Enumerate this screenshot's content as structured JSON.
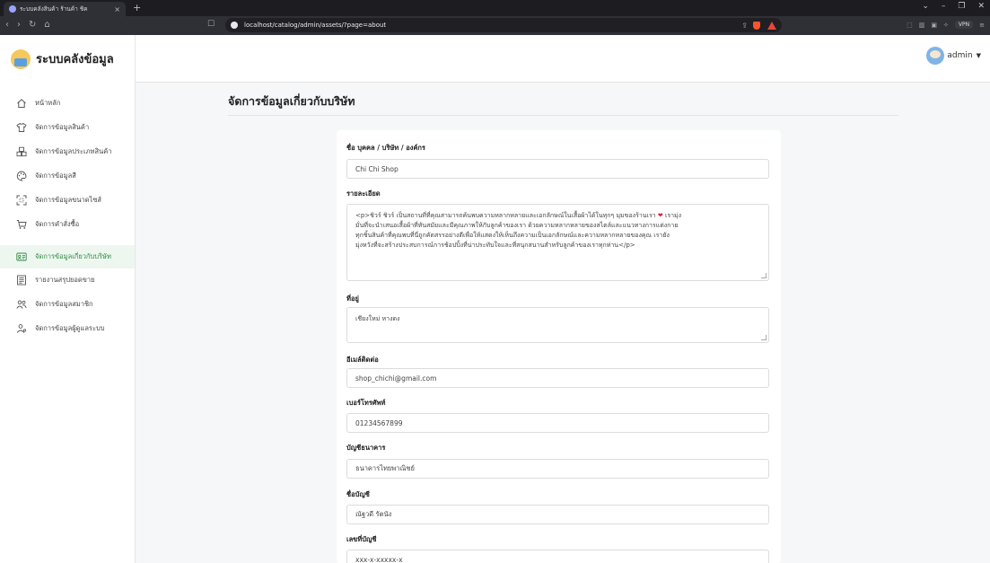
{
  "browser": {
    "tab_title": "ระบบคลังสินค้า ร้านค้า ชิค",
    "tab_close": "×",
    "new_tab": "+",
    "url": "localhost/catalog/admin/assets/?page=about",
    "vpn_label": "VPN",
    "window_controls": [
      "⌄",
      "–",
      "❐",
      "✕"
    ]
  },
  "app": {
    "brand": "ระบบคลังข้อมูล",
    "user": "admin"
  },
  "sidebar": {
    "items": [
      {
        "label": "หน้าหลัก",
        "icon": "home-icon"
      },
      {
        "label": "จัดการข้อมูลสินค้า",
        "icon": "shirt-icon"
      },
      {
        "label": "จัดการข้อมูลประเภทสินค้า",
        "icon": "boxes-icon"
      },
      {
        "label": "จัดการข้อมูลสี",
        "icon": "palette-icon"
      },
      {
        "label": "จัดการข้อมูลขนาดไซส์",
        "icon": "resize-icon"
      },
      {
        "label": "จัดการคำสั่งซื้อ",
        "icon": "cart-icon"
      },
      {
        "label": "จัดการข้อมูลเกี่ยวกับบริษัท",
        "icon": "id-card-icon",
        "active": true
      },
      {
        "label": "รายงานสรุปยอดขาย",
        "icon": "report-icon"
      },
      {
        "label": "จัดการข้อมูลสมาชิก",
        "icon": "members-icon"
      },
      {
        "label": "จัดการข้อมูลผู้ดูแลระบบ",
        "icon": "admin-users-icon"
      }
    ]
  },
  "page": {
    "title": "จัดการข้อมูลเกี่ยวกับบริษัท"
  },
  "form": {
    "name_label": "ชื่อ บุคคล / บริษัท / องค์กร",
    "name_value": "Chi Chi Shop",
    "detail_label": "รายละเอียด",
    "detail_line1_a": "<p>ชิวร์ ชิวร์ เป็นสถานที่ที่คุณสามารถค้นพบความหลากหลายและเอกลักษณ์ในเสื้อผ้าได้ในทุกๆ มุมของร้านเรา ",
    "detail_heart": "❤",
    "detail_line1_b": " เรามุ่ง",
    "detail_line2": "มั่นที่จะนำเสนอเสื้อผ้าที่ทันสมัยและมีคุณภาพให้กับลูกค้าของเรา ด้วยความหลากหลายของสไตล์และแนวทางการแต่งกาย",
    "detail_line3": "ทุกชิ้นสินค้าที่คุณพบที่นี่ถูกคัดสรรอย่างดีเพื่อให้แสดงให้เห็นถึงความเป็นเอกลักษณ์และความหลากหลายของคุณ เรายัง",
    "detail_line4": "มุ่งหวังที่จะสร้างประสบการณ์การช้อปปิ้งที่น่าประทับใจและที่สนุกสนานสำหรับลูกค้าของเราทุกท่าน</p>",
    "address_label": "ที่อยู่",
    "address_value": "เชียงใหม่ หางดง",
    "email_label": "อีเมล์ติดต่อ",
    "email_value": "shop_chichi@gmail.com",
    "phone_label": "เบอร์โทรศัพท์",
    "phone_value": "01234567899",
    "bank_label": "บัญชีธนาคาร",
    "bank_value": "ธนาคารไทยพาณิชย์",
    "account_name_label": "ชื่อบัญชี",
    "account_name_value": "ณัฐวดี รัตนัง",
    "account_no_label": "เลขที่บัญชี",
    "account_no_value": "xxx-x-xxxxx-x"
  }
}
